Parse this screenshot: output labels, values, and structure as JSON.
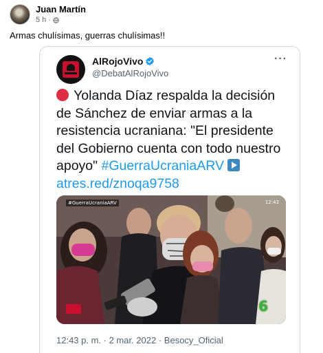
{
  "fb_post": {
    "author": "Juan Martín",
    "time": "5 h",
    "separator": "·",
    "text": "Armas chulísimas, guerras chulísimas!!"
  },
  "tweet": {
    "name": "AlRojoVivo",
    "handle": "@DebatAlRojoVivo",
    "more_label": "···",
    "text": "Yolanda Díaz respalda la decisión de Sánchez de enviar armas a la resistencia ucraniana: \"El presidente del Gobierno cuenta con todo nuestro apoyo\"",
    "hashtag": "#GuerraUcraniaARV",
    "link": "atres.red/znoqa9758",
    "media": {
      "tag": "#GuerraUcraniaARV",
      "time": "12:43",
      "channel_logo": "6"
    },
    "footer": "12:43 p. m. · 2 mar. 2022 · Besocy_Oficial"
  },
  "colors": {
    "link": "#1d9bf0",
    "verified": "#1d9bf0",
    "red_circle": "#dd2e44"
  }
}
